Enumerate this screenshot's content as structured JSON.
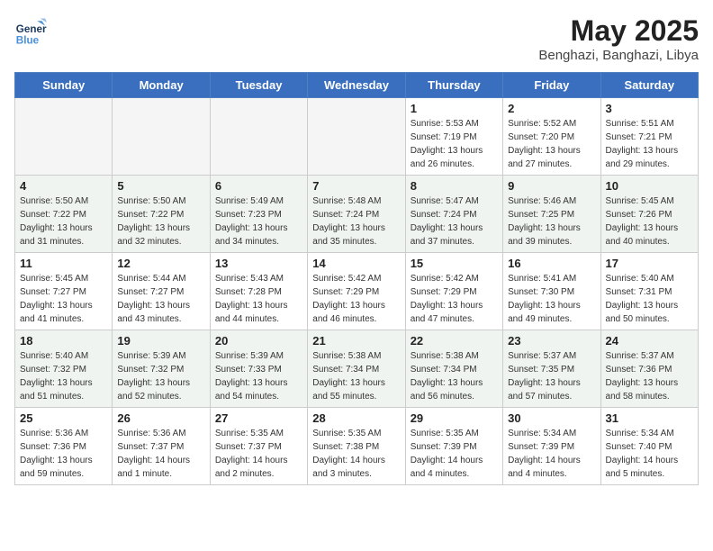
{
  "header": {
    "logo_line1": "General",
    "logo_line2": "Blue",
    "month_year": "May 2025",
    "location": "Benghazi, Banghazi, Libya"
  },
  "weekdays": [
    "Sunday",
    "Monday",
    "Tuesday",
    "Wednesday",
    "Thursday",
    "Friday",
    "Saturday"
  ],
  "weeks": [
    [
      {
        "day": "",
        "empty": true
      },
      {
        "day": "",
        "empty": true
      },
      {
        "day": "",
        "empty": true
      },
      {
        "day": "",
        "empty": true
      },
      {
        "day": "1",
        "sunrise": "5:53 AM",
        "sunset": "7:19 PM",
        "daylight": "13 hours and 26 minutes."
      },
      {
        "day": "2",
        "sunrise": "5:52 AM",
        "sunset": "7:20 PM",
        "daylight": "13 hours and 27 minutes."
      },
      {
        "day": "3",
        "sunrise": "5:51 AM",
        "sunset": "7:21 PM",
        "daylight": "13 hours and 29 minutes."
      }
    ],
    [
      {
        "day": "4",
        "sunrise": "5:50 AM",
        "sunset": "7:22 PM",
        "daylight": "13 hours and 31 minutes."
      },
      {
        "day": "5",
        "sunrise": "5:50 AM",
        "sunset": "7:22 PM",
        "daylight": "13 hours and 32 minutes."
      },
      {
        "day": "6",
        "sunrise": "5:49 AM",
        "sunset": "7:23 PM",
        "daylight": "13 hours and 34 minutes."
      },
      {
        "day": "7",
        "sunrise": "5:48 AM",
        "sunset": "7:24 PM",
        "daylight": "13 hours and 35 minutes."
      },
      {
        "day": "8",
        "sunrise": "5:47 AM",
        "sunset": "7:24 PM",
        "daylight": "13 hours and 37 minutes."
      },
      {
        "day": "9",
        "sunrise": "5:46 AM",
        "sunset": "7:25 PM",
        "daylight": "13 hours and 39 minutes."
      },
      {
        "day": "10",
        "sunrise": "5:45 AM",
        "sunset": "7:26 PM",
        "daylight": "13 hours and 40 minutes."
      }
    ],
    [
      {
        "day": "11",
        "sunrise": "5:45 AM",
        "sunset": "7:27 PM",
        "daylight": "13 hours and 41 minutes."
      },
      {
        "day": "12",
        "sunrise": "5:44 AM",
        "sunset": "7:27 PM",
        "daylight": "13 hours and 43 minutes."
      },
      {
        "day": "13",
        "sunrise": "5:43 AM",
        "sunset": "7:28 PM",
        "daylight": "13 hours and 44 minutes."
      },
      {
        "day": "14",
        "sunrise": "5:42 AM",
        "sunset": "7:29 PM",
        "daylight": "13 hours and 46 minutes."
      },
      {
        "day": "15",
        "sunrise": "5:42 AM",
        "sunset": "7:29 PM",
        "daylight": "13 hours and 47 minutes."
      },
      {
        "day": "16",
        "sunrise": "5:41 AM",
        "sunset": "7:30 PM",
        "daylight": "13 hours and 49 minutes."
      },
      {
        "day": "17",
        "sunrise": "5:40 AM",
        "sunset": "7:31 PM",
        "daylight": "13 hours and 50 minutes."
      }
    ],
    [
      {
        "day": "18",
        "sunrise": "5:40 AM",
        "sunset": "7:32 PM",
        "daylight": "13 hours and 51 minutes."
      },
      {
        "day": "19",
        "sunrise": "5:39 AM",
        "sunset": "7:32 PM",
        "daylight": "13 hours and 52 minutes."
      },
      {
        "day": "20",
        "sunrise": "5:39 AM",
        "sunset": "7:33 PM",
        "daylight": "13 hours and 54 minutes."
      },
      {
        "day": "21",
        "sunrise": "5:38 AM",
        "sunset": "7:34 PM",
        "daylight": "13 hours and 55 minutes."
      },
      {
        "day": "22",
        "sunrise": "5:38 AM",
        "sunset": "7:34 PM",
        "daylight": "13 hours and 56 minutes."
      },
      {
        "day": "23",
        "sunrise": "5:37 AM",
        "sunset": "7:35 PM",
        "daylight": "13 hours and 57 minutes."
      },
      {
        "day": "24",
        "sunrise": "5:37 AM",
        "sunset": "7:36 PM",
        "daylight": "13 hours and 58 minutes."
      }
    ],
    [
      {
        "day": "25",
        "sunrise": "5:36 AM",
        "sunset": "7:36 PM",
        "daylight": "13 hours and 59 minutes."
      },
      {
        "day": "26",
        "sunrise": "5:36 AM",
        "sunset": "7:37 PM",
        "daylight": "14 hours and 1 minute."
      },
      {
        "day": "27",
        "sunrise": "5:35 AM",
        "sunset": "7:37 PM",
        "daylight": "14 hours and 2 minutes."
      },
      {
        "day": "28",
        "sunrise": "5:35 AM",
        "sunset": "7:38 PM",
        "daylight": "14 hours and 3 minutes."
      },
      {
        "day": "29",
        "sunrise": "5:35 AM",
        "sunset": "7:39 PM",
        "daylight": "14 hours and 4 minutes."
      },
      {
        "day": "30",
        "sunrise": "5:34 AM",
        "sunset": "7:39 PM",
        "daylight": "14 hours and 4 minutes."
      },
      {
        "day": "31",
        "sunrise": "5:34 AM",
        "sunset": "7:40 PM",
        "daylight": "14 hours and 5 minutes."
      }
    ]
  ],
  "labels": {
    "sunrise": "Sunrise:",
    "sunset": "Sunset:",
    "daylight": "Daylight:"
  }
}
